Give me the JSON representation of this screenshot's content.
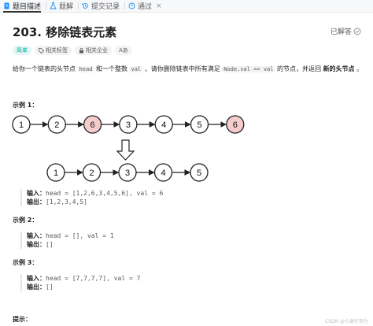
{
  "tabs": [
    {
      "label": "题目描述",
      "icon": "document-icon"
    },
    {
      "label": "题解",
      "icon": "flask-icon"
    },
    {
      "label": "提交记录",
      "icon": "history-icon"
    },
    {
      "label": "通过",
      "icon": "clock-icon",
      "close": "×"
    }
  ],
  "problem": {
    "title": "203. 移除链表元素",
    "status": "已解答",
    "tags": {
      "difficulty": "简单",
      "related_tags": "相关标签",
      "related_companies": "相关企业",
      "font_size": "Aあ"
    }
  },
  "description": {
    "p1": "给你一个链表的头节点",
    "c1": "head",
    "p2": "和一个整数",
    "c2": "val",
    "p3": "，请你删除链表中所有满足",
    "c3": "Node.val == val",
    "p4": "的节点，并返回",
    "b1": "新的头节点",
    "p5": "。"
  },
  "examples": [
    {
      "title": "示例 1：",
      "input_label": "输入：",
      "input": "head = [1,2,6,3,4,5,6], val = 6",
      "output_label": "输出：",
      "output": "[1,2,3,4,5]"
    },
    {
      "title": "示例 2：",
      "input_label": "输入：",
      "input": "head = [], val = 1",
      "output_label": "输出：",
      "output": "[]"
    },
    {
      "title": "示例 3：",
      "input_label": "输入：",
      "input": "head = [7,7,7,7], val = 7",
      "output_label": "输出：",
      "output": "[]"
    }
  ],
  "hint_title": "提示：",
  "diagram": {
    "before": [
      {
        "v": "1",
        "removed": false
      },
      {
        "v": "2",
        "removed": false
      },
      {
        "v": "6",
        "removed": true
      },
      {
        "v": "3",
        "removed": false
      },
      {
        "v": "4",
        "removed": false
      },
      {
        "v": "5",
        "removed": false
      },
      {
        "v": "6",
        "removed": true
      }
    ],
    "after": [
      "1",
      "2",
      "3",
      "4",
      "5"
    ],
    "removed_fill": "#f4cccc",
    "normal_fill": "#ffffff"
  },
  "watermark": "CSDN @小谢在努力"
}
